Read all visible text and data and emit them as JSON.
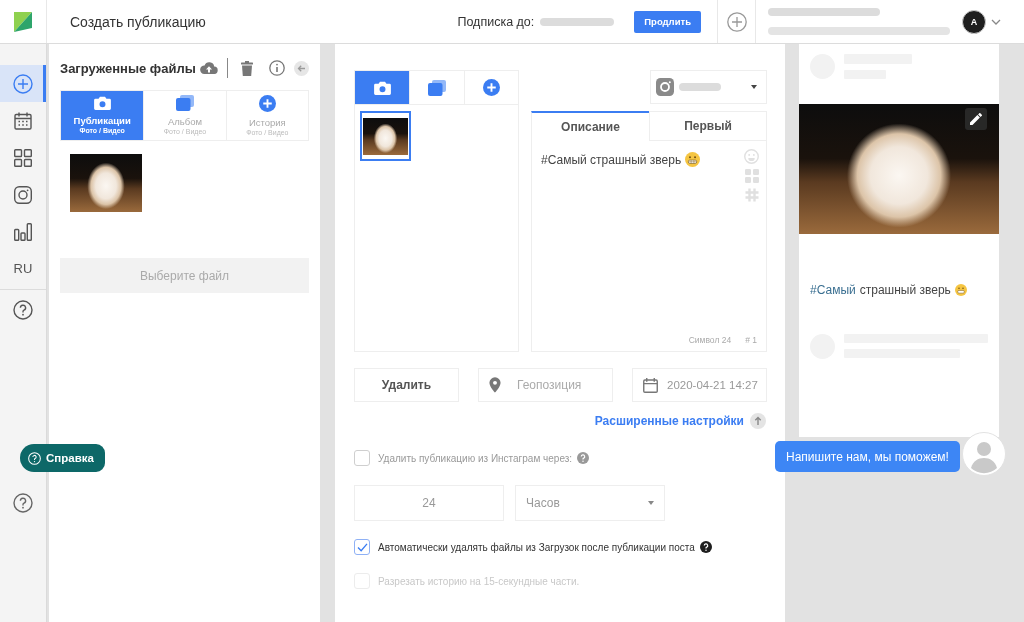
{
  "topbar": {
    "title": "Создать публикацию",
    "subscription_label": "Подписка до:",
    "renew_button": "Продлить",
    "avatar_letter": "A"
  },
  "sidebar": {
    "items": [
      {
        "kind": "add",
        "selected": true
      },
      {
        "kind": "calendar",
        "selected": false
      },
      {
        "kind": "grid",
        "selected": false
      },
      {
        "kind": "instagram",
        "selected": false
      },
      {
        "kind": "stats",
        "selected": false
      },
      {
        "kind": "language",
        "label": "RU",
        "selected": false
      },
      {
        "kind": "help",
        "selected": false
      }
    ]
  },
  "uploads": {
    "title": "Загруженные файлы",
    "tabs": [
      {
        "kind": "photo",
        "label": "Публикации",
        "sublabel": "Фото / Видео",
        "selected": true
      },
      {
        "kind": "album",
        "label": "Альбом",
        "sublabel": "Фото / Видео",
        "selected": false
      },
      {
        "kind": "story",
        "label": "История",
        "sublabel": "Фото / Видео",
        "selected": false
      }
    ],
    "choose_button": "Выберите файл"
  },
  "editor": {
    "media_tabs": [
      {
        "kind": "photo",
        "selected": true
      },
      {
        "kind": "album",
        "selected": false
      },
      {
        "kind": "story",
        "selected": false
      }
    ],
    "media_items": [
      {
        "selected": true
      }
    ],
    "caption_tabs": [
      {
        "label": "Описание",
        "selected": true
      },
      {
        "label": "Первый",
        "selected": false
      }
    ],
    "caption_text": "#Самый страшный зверь",
    "char_count": "Символ 24",
    "hashtag_count": "# 1",
    "delete_button": "Удалить",
    "location": {
      "placeholder": "Геопозиция"
    },
    "date": {
      "value": "2020-04-21 14:27"
    },
    "advanced_link": "Расширенные настройки",
    "options": [
      {
        "label": "Удалить публикацию из Инстаграм через:",
        "checked": false,
        "disabled": false,
        "help": true,
        "hours": {
          "value": "24"
        },
        "unit": {
          "value": "Часов"
        }
      },
      {
        "label": "Автоматически удалять файлы из Загрузок после публикации поста",
        "checked": true,
        "disabled": false,
        "help": true
      },
      {
        "label": "Разрезать историю на 15-секундные части.",
        "checked": false,
        "disabled": true,
        "help": false
      }
    ]
  },
  "preview": {
    "hashtag": "#Самый",
    "caption": "страшный зверь"
  },
  "help_widget": {
    "label": "Справка"
  },
  "chat": {
    "message": "Напишите нам, мы поможем!"
  }
}
